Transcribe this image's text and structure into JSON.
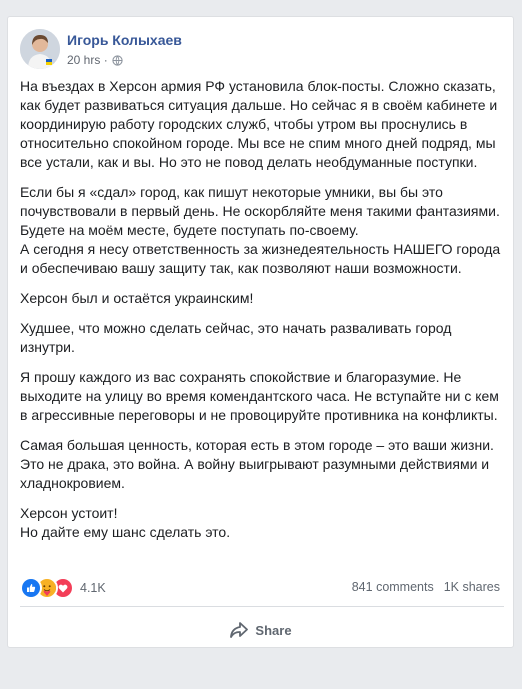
{
  "post": {
    "author": "Игорь Колыхаев",
    "time": "20 hrs",
    "privacy_icon": "globe-icon",
    "paragraphs": [
      "На въездах в Херсон армия РФ установила блок-посты. Сложно сказать, как будет развиваться ситуация дальше. Но сейчас я в своём кабинете и координирую работу городских служб, чтобы утром вы проснулись в относительно спокойном городе. Мы все не спим много дней подряд, мы все устали, как и вы. Но это не повод делать необдуманные поступки.",
      "Если бы я «сдал» город, как пишут некоторые умники, вы бы это почувствовали в первый день. Не оскорбляйте меня такими фантазиями. Будете на моём месте, будете поступать по-своему.\nА сегодня я несу ответственность за жизнедеятельность НАШЕГО города и обеспечиваю вашу защиту так, как позволяют наши возможности.",
      "Херсон был и остаётся украинским!",
      "Худшее, что можно сделать сейчас, это начать разваливать город изнутри.",
      "Я прошу каждого из вас сохранять спокойствие и благоразумие. Не выходите на улицу во время комендантского часа. Не вступайте ни с кем в агрессивные переговоры и не провоцируйте противника на конфликты.",
      "Самая большая ценность, которая есть в этом городе – это ваши жизни. Это не драка, это война. А войну выигрывают разумными действиями и хладнокровием.",
      "Херсон устоит!\nНо дайте ему шанс сделать это."
    ]
  },
  "stats": {
    "reactions": [
      "like-icon",
      "care-icon",
      "love-icon"
    ],
    "reaction_count": "4.1K",
    "comments": "841 comments",
    "shares": "1K shares"
  },
  "actions": {
    "share_label": "Share",
    "share_icon": "share-arrow-icon"
  },
  "colors": {
    "author_link": "#385898",
    "like_blue": "#1877f2",
    "love_red": "#f33e58",
    "care_yellow": "#f7b125",
    "background": "#e9ebee"
  }
}
